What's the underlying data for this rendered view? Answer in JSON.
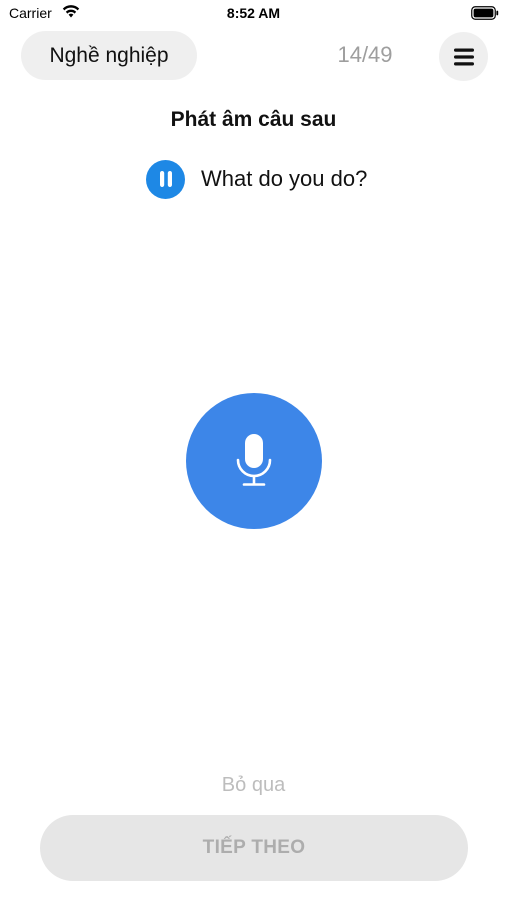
{
  "status_bar": {
    "carrier": "Carrier",
    "time": "8:52 AM",
    "wifi_icon": "wifi-icon",
    "battery_icon": "battery-icon"
  },
  "header": {
    "topic": "Nghề nghiệp",
    "progress": "14/49",
    "progress_current": 14,
    "progress_total": 49,
    "menu_icon": "hamburger-menu-icon"
  },
  "exercise": {
    "instruction": "Phát âm câu sau",
    "sentence": "What do you do?",
    "audio_state_icon": "pause-icon",
    "mic_icon": "microphone-icon"
  },
  "footer": {
    "skip_label": "Bỏ qua",
    "next_label": "TIẾP THEO"
  },
  "colors": {
    "accent_blue": "#1e88e5",
    "mic_blue": "#3d86e8",
    "pill_gray": "#efefef",
    "disabled_gray": "#e6e6e6",
    "disabled_text": "#adadad"
  }
}
